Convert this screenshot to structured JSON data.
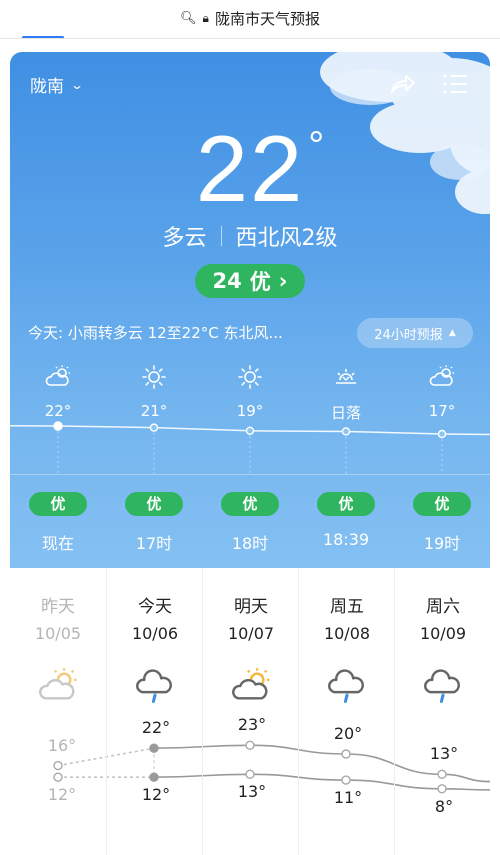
{
  "browser": {
    "url_text": "陇南市天气预报"
  },
  "header": {
    "city": "陇南"
  },
  "current": {
    "temp": "22",
    "degree": "°",
    "weather": "多云",
    "wind": "西北风2级",
    "aqi_value": "24",
    "aqi_label": "优",
    "summary": "今天: 小雨转多云  12至22°C  东北风...",
    "forecast_button": "24小时预报"
  },
  "hourly": [
    {
      "temp": "22°",
      "icon": "partly-cloudy-icon",
      "aqi": "优",
      "time": "现在"
    },
    {
      "temp": "21°",
      "icon": "sun-icon",
      "aqi": "优",
      "time": "17时"
    },
    {
      "temp": "19°",
      "icon": "sun-icon",
      "aqi": "优",
      "time": "18时"
    },
    {
      "temp": "日落",
      "icon": "sunset-icon",
      "aqi": "优",
      "time": "18:39"
    },
    {
      "temp": "17°",
      "icon": "partly-cloudy-icon",
      "aqi": "优",
      "time": "19时"
    }
  ],
  "hourly_levels": [
    22,
    21,
    19,
    18.6,
    17
  ],
  "daily": [
    {
      "name": "昨天",
      "date": "10/05",
      "icon": "partly-cloudy-icon",
      "high": "16°",
      "low": "12°",
      "high_val": 16,
      "low_val": 12
    },
    {
      "name": "今天",
      "date": "10/06",
      "icon": "rain-icon",
      "high": "22°",
      "low": "12°",
      "high_val": 22,
      "low_val": 12
    },
    {
      "name": "明天",
      "date": "10/07",
      "icon": "partly-cloudy-icon",
      "high": "23°",
      "low": "13°",
      "high_val": 23,
      "low_val": 13
    },
    {
      "name": "周五",
      "date": "10/08",
      "icon": "rain-icon",
      "high": "20°",
      "low": "11°",
      "high_val": 20,
      "low_val": 11
    },
    {
      "name": "周六",
      "date": "10/09",
      "icon": "rain-icon",
      "high": "13°",
      "low": "8°",
      "high_val": 13,
      "low_val": 8
    }
  ],
  "colors": {
    "sky_top": "#3f8fe3",
    "sky_bottom": "#84c0f2",
    "aqi_green": "#2fb55f",
    "sun": "#f6b73c"
  }
}
